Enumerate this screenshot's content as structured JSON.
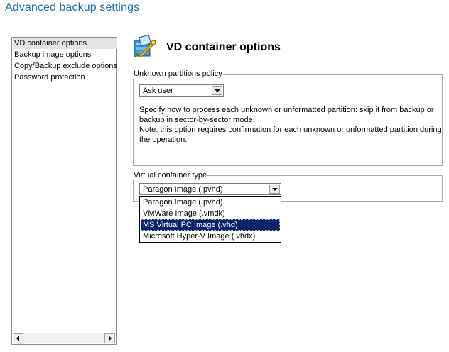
{
  "page": {
    "title": "Advanced backup settings"
  },
  "nav": {
    "items": [
      {
        "label": "VD container options",
        "selected": true
      },
      {
        "label": "Backup image options"
      },
      {
        "label": "Copy/Backup exclude options"
      },
      {
        "label": "Password protection"
      }
    ]
  },
  "section": {
    "icon": "wrench-container-icon",
    "heading": "VD container options"
  },
  "unknown_partitions": {
    "legend": "Unknown partitions policy",
    "selected": "Ask user",
    "description_line1": "Specify how to process each unknown or unformatted partition: skip it from backup or",
    "description_line2": "backup in sector-by-sector mode.",
    "note_line1": "Note: this option requires confirmation for each unknown or unformatted partition during",
    "note_line2": "the operation."
  },
  "virtual_container": {
    "legend": "Virtual container type",
    "selected": "Paragon Image (.pvhd)",
    "options": [
      "Paragon Image (.pvhd)",
      "VMWare Image (.vmdk)",
      "MS Virtual PC Image (.vhd)",
      "Microsoft Hyper-V Image (.vhdx)"
    ],
    "highlighted_index": 2
  },
  "colors": {
    "title": "#1e6fa8",
    "highlight": "#0a246a",
    "nav_selected": "#e3e3e3"
  }
}
